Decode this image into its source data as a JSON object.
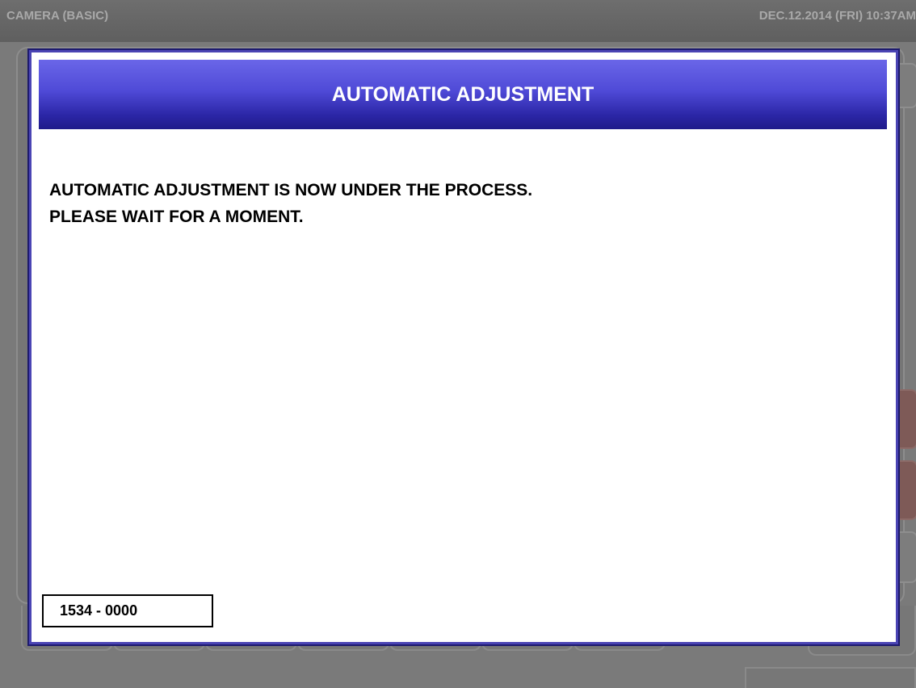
{
  "status_bar": {
    "screen_title": "CAMERA (BASIC)",
    "datetime": "DEC.12.2014 (FRI)  10:37AM"
  },
  "dialog": {
    "title": "AUTOMATIC ADJUSTMENT",
    "message_line1": "AUTOMATIC ADJUSTMENT IS NOW UNDER THE PROCESS.",
    "message_line2": "PLEASE WAIT FOR A MOMENT.",
    "code": "1534 - 0000"
  },
  "colors": {
    "header_gradient_top": "#6a66e8",
    "header_gradient_bottom": "#1f1a8a",
    "dialog_border": "#4a44b4",
    "background_overlay": "#7a7a7a"
  }
}
